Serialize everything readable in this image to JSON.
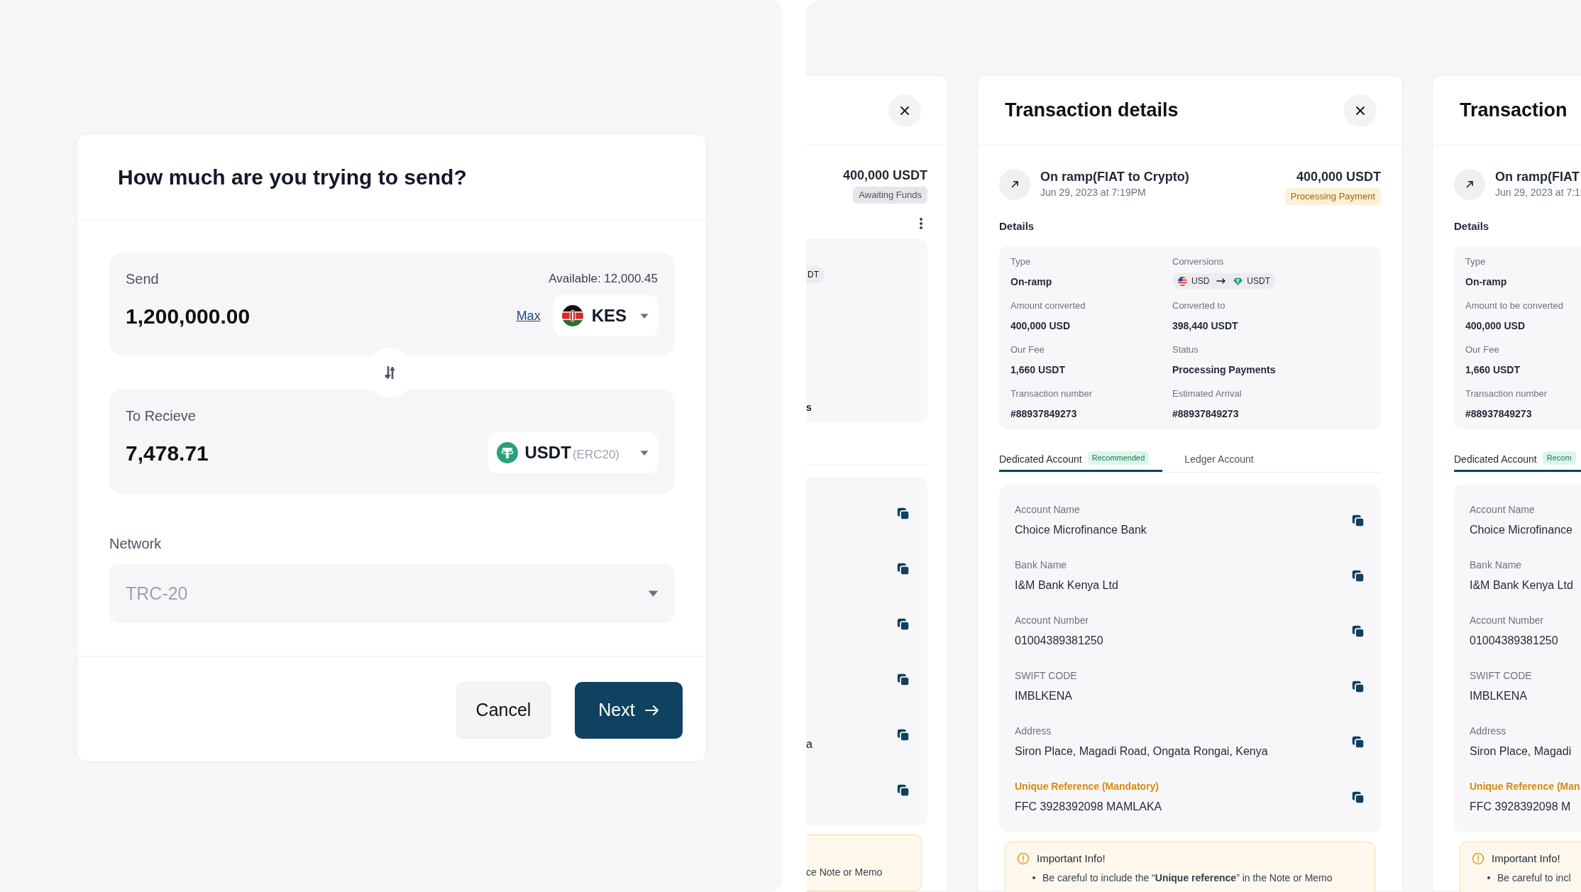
{
  "send_dialog": {
    "title": "How much are you trying to send?",
    "send": {
      "label": "Send",
      "available": "Available: 12,000.45",
      "amount": "1,200,000.00",
      "max_link": "Max",
      "currency": "KES"
    },
    "receive": {
      "label": "To Recieve",
      "amount": "7,478.71",
      "currency": "USDT",
      "currency_network": "(ERC20)"
    },
    "network": {
      "label": "Network",
      "value": "TRC-20",
      "disabled": true
    },
    "buttons": [
      {
        "label": "Cancel",
        "kind": "secondary"
      },
      {
        "label": "Next",
        "kind": "primary"
      }
    ]
  },
  "partial_panel_left": {
    "amount": "400,000 USDT",
    "status": "Awaiting Funds",
    "details_fragments": [
      "DT",
      "s"
    ],
    "account_value_fragment": "a",
    "info_fragment": "ce Note or Memo"
  },
  "transaction_panel": {
    "title": "Transaction details",
    "summary": {
      "title": "On ramp(FIAT to Crypto)",
      "date": "Jun 29, 2023 at 7:19PM",
      "amount": "400,000 USDT",
      "status": "Processing Payment"
    },
    "details_heading": "Details",
    "details": [
      {
        "label": "Type",
        "value": "On-ramp",
        "kind": "text"
      },
      {
        "label": "Conversions",
        "kind": "conversion",
        "from": "USD",
        "to": "USDT"
      },
      {
        "label": "Amount converted",
        "value": "400,000 USD",
        "kind": "text"
      },
      {
        "label": "Converted to",
        "value": "398,440 USDT",
        "kind": "text"
      },
      {
        "label": "Our Fee",
        "value": "1,660 USDT",
        "kind": "text"
      },
      {
        "label": "Status",
        "value": "Processing Payments",
        "kind": "text"
      },
      {
        "label": "Transaction number",
        "value": "#88937849273",
        "kind": "text"
      },
      {
        "label": "Estimated Arrival",
        "value": "#88937849273",
        "kind": "text"
      }
    ],
    "tabs": [
      {
        "label": "Dedicated Account",
        "badge": "Recommended",
        "selected": true
      },
      {
        "label": "Ledger Account",
        "selected": false
      }
    ],
    "account_fields": [
      {
        "label": "Account Name",
        "value": "Choice Microfinance Bank",
        "highlighted": false
      },
      {
        "label": "Bank Name",
        "value": "I&M Bank Kenya Ltd",
        "highlighted": false
      },
      {
        "label": "Account Number",
        "value": "01004389381250",
        "highlighted": false
      },
      {
        "label": "SWIFT CODE",
        "value": "IMBLKENA",
        "highlighted": false
      },
      {
        "label": "Address",
        "value": "Siron Place, Magadi Road, Ongata Rongai, Kenya",
        "highlighted": false
      },
      {
        "label": "Unique Reference (Mandatory)",
        "value": "FFC 3928392098 MAMLAKA",
        "highlighted": true
      }
    ],
    "info": {
      "title": "Important Info!",
      "items": [
        "Be careful to include the “**Unique reference**” in the Note or Memo"
      ]
    }
  },
  "partial_panel_right": {
    "title": "Transaction",
    "summary": {
      "title": "On ramp(FIAT",
      "date": "Jun 29, 2023 at 7:1"
    },
    "details_heading": "Details",
    "details": [
      {
        "label": "Type",
        "value": "On-ramp",
        "kind": "text"
      },
      {
        "label": "Amount to be converted",
        "value": "400,000 USD",
        "kind": "text"
      },
      {
        "label": "Our Fee",
        "value": "1,660 USDT",
        "kind": "text"
      },
      {
        "label": "Transaction number",
        "value": "#88937849273",
        "kind": "text"
      }
    ],
    "tabs": [
      {
        "label": "Dedicated Account",
        "badge": "Recom",
        "selected": true
      }
    ],
    "account_fields": [
      {
        "label": "Account Name",
        "value": "Choice Microfinance",
        "highlighted": false
      },
      {
        "label": "Bank Name",
        "value": "I&M Bank Kenya Ltd",
        "highlighted": false
      },
      {
        "label": "Account Number",
        "value": "01004389381250",
        "highlighted": false
      },
      {
        "label": "SWIFT CODE",
        "value": "IMBLKENA",
        "highlighted": false
      },
      {
        "label": "Address",
        "value": "Siron Place, Magadi",
        "highlighted": false
      },
      {
        "label": "Unique Reference (Man",
        "value": "FFC 3928392098 M",
        "highlighted": true
      }
    ],
    "info": {
      "title": "Important Info!",
      "items": [
        "Be careful to incl"
      ]
    }
  }
}
